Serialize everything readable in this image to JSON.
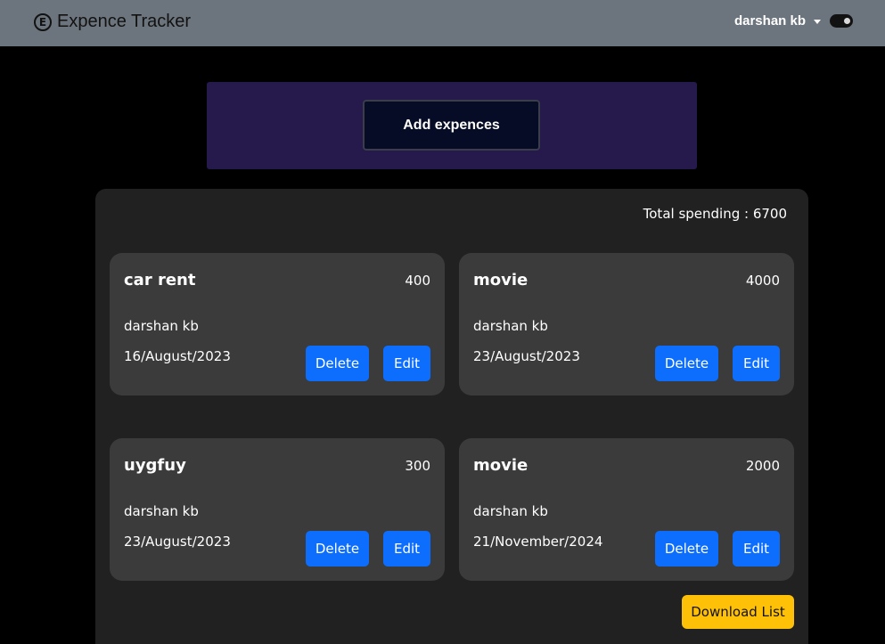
{
  "header": {
    "brand_icon_glyph": "E",
    "brand_icon": "e-circle-icon",
    "title": "Expence Tracker",
    "user_name": "darshan kb",
    "user_caret_icon": "caret-down-icon",
    "theme_toggle_icon": "toggle-switch-icon",
    "theme_toggle_on": true
  },
  "add_panel": {
    "button_label": "Add expences"
  },
  "summary": {
    "total_text": "Total spending : 6700"
  },
  "expenses": [
    {
      "title": "car rent",
      "amount": "400",
      "user": "darshan kb",
      "date": "16/August/2023",
      "delete_label": "Delete",
      "edit_label": "Edit"
    },
    {
      "title": "movie",
      "amount": "4000",
      "user": "darshan kb",
      "date": "23/August/2023",
      "delete_label": "Delete",
      "edit_label": "Edit"
    },
    {
      "title": "uygfuy",
      "amount": "300",
      "user": "darshan kb",
      "date": "23/August/2023",
      "delete_label": "Delete",
      "edit_label": "Edit"
    },
    {
      "title": "movie",
      "amount": "2000",
      "user": "darshan kb",
      "date": "21/November/2024",
      "delete_label": "Delete",
      "edit_label": "Edit"
    }
  ],
  "footer": {
    "download_label": "Download List"
  },
  "colors": {
    "navbar": "#6c757d",
    "page_background": "#000000",
    "add_panel": "#261a4c",
    "add_button": "#060c25",
    "list_panel": "#212121",
    "card": "#3b3b3b",
    "primary_button": "#0d6efd",
    "download_button": "#ffc107"
  }
}
